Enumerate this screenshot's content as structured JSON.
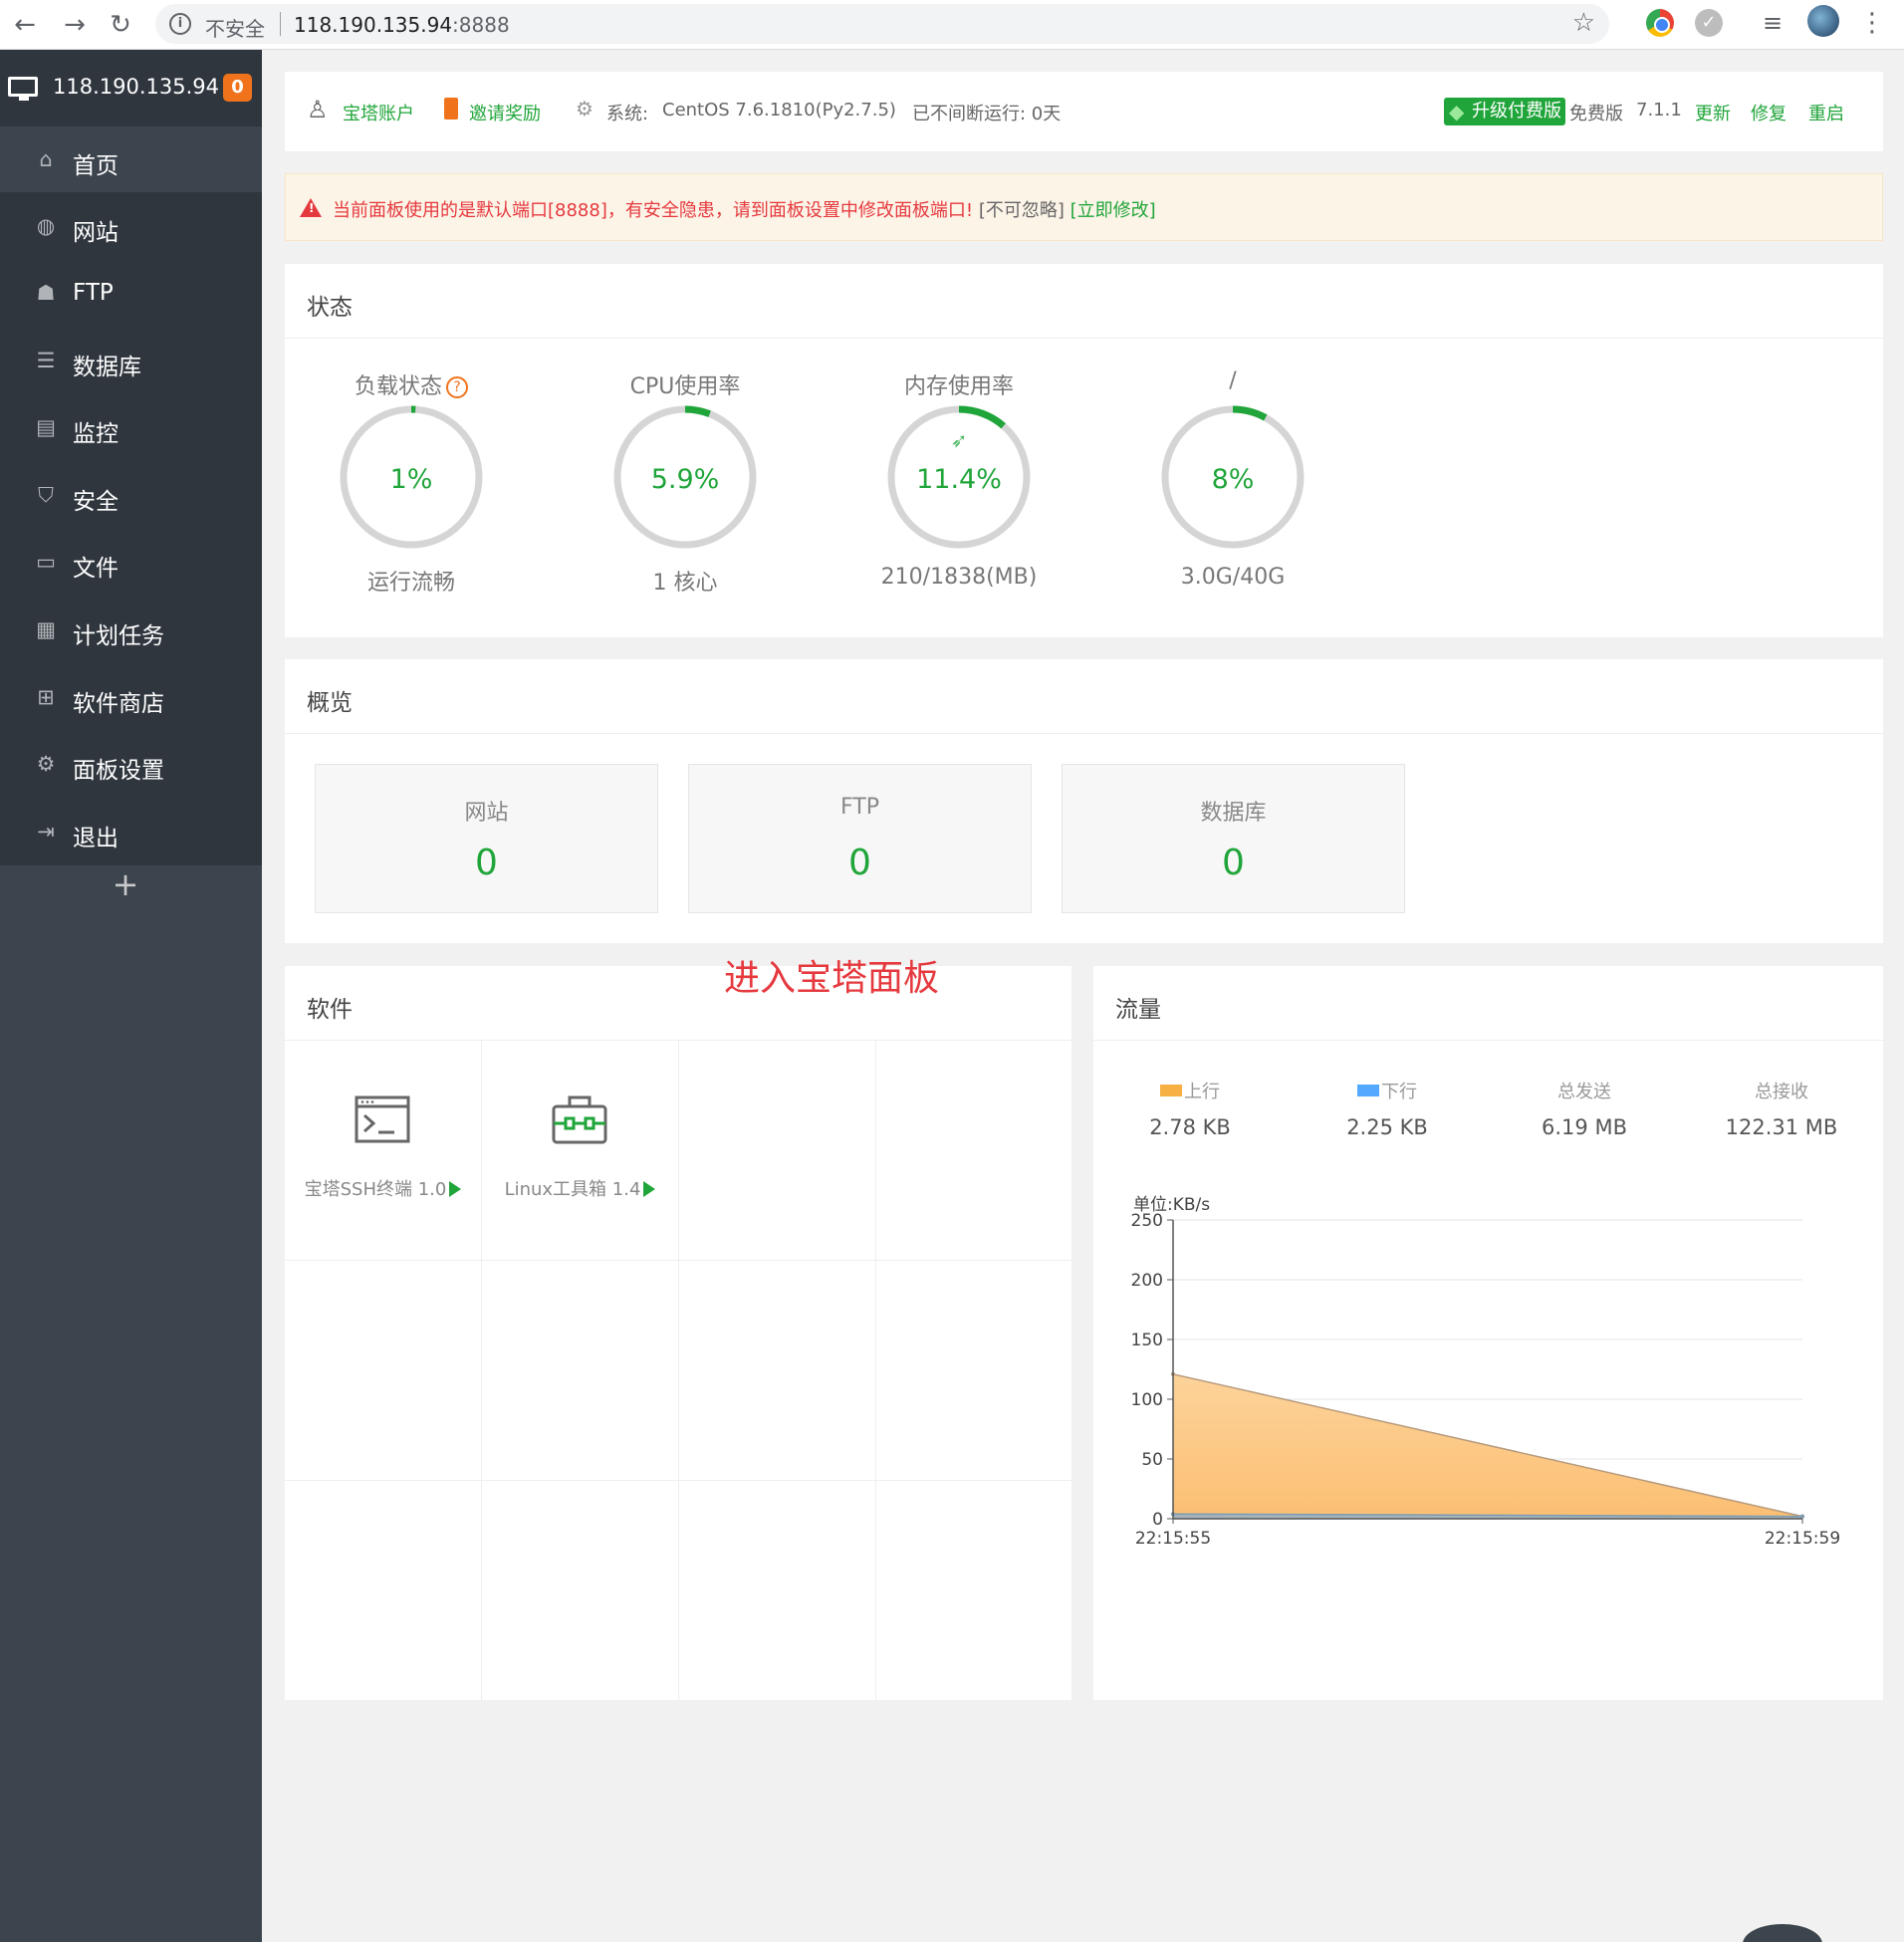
{
  "browser": {
    "insecure_label": "不安全",
    "url_host": "118.190.135.94",
    "url_port": ":8888"
  },
  "sidebar": {
    "ip": "118.190.135.94",
    "badge": "0",
    "items": [
      {
        "label": "首页",
        "icon": "home-icon"
      },
      {
        "label": "网站",
        "icon": "globe-icon"
      },
      {
        "label": "FTP",
        "icon": "ftp-icon"
      },
      {
        "label": "数据库",
        "icon": "database-icon"
      },
      {
        "label": "监控",
        "icon": "monitor-icon"
      },
      {
        "label": "安全",
        "icon": "shield-icon"
      },
      {
        "label": "文件",
        "icon": "folder-icon"
      },
      {
        "label": "计划任务",
        "icon": "calendar-icon"
      },
      {
        "label": "软件商店",
        "icon": "apps-icon"
      },
      {
        "label": "面板设置",
        "icon": "gear-icon"
      },
      {
        "label": "退出",
        "icon": "logout-icon"
      }
    ],
    "add": "+"
  },
  "topbar": {
    "account": "宝塔账户",
    "invite": "邀请奖励",
    "system_label": "系统:",
    "system_value": "CentOS 7.6.1810(Py2.7.5)",
    "uptime": "已不间断运行: 0天",
    "upgrade": "升级付费版",
    "edition": "免费版",
    "version": "7.1.1",
    "update": "更新",
    "repair": "修复",
    "restart": "重启"
  },
  "alert": {
    "message": "当前面板使用的是默认端口[8888]，有安全隐患，请到面板设置中修改面板端口!",
    "ignore": "[不可忽略]",
    "fix": "[立即修改]"
  },
  "status": {
    "title": "状态",
    "gauges": [
      {
        "title": "负载状态",
        "value": "1%",
        "percent": 1,
        "sub": "运行流畅"
      },
      {
        "title": "CPU使用率",
        "value": "5.9%",
        "percent": 5.9,
        "sub": "1 核心"
      },
      {
        "title": "内存使用率",
        "value": "11.4%",
        "percent": 11.4,
        "sub": "210/1838(MB)"
      },
      {
        "title": "/",
        "value": "8%",
        "percent": 8,
        "sub": "3.0G/40G"
      }
    ]
  },
  "overview": {
    "title": "概览",
    "cards": [
      {
        "label": "网站",
        "value": "0"
      },
      {
        "label": "FTP",
        "value": "0"
      },
      {
        "label": "数据库",
        "value": "0"
      }
    ]
  },
  "software": {
    "title": "软件",
    "items": [
      {
        "label": "宝塔SSH终端 1.0",
        "icon": "terminal-icon"
      },
      {
        "label": "Linux工具箱 1.4",
        "icon": "toolbox-icon"
      }
    ]
  },
  "overlay_text": "进入宝塔面板",
  "traffic": {
    "title": "流量",
    "stats": [
      {
        "label": "上行",
        "value": "2.78 KB",
        "color": "#f6b043"
      },
      {
        "label": "下行",
        "value": "2.25 KB",
        "color": "#52a9ff"
      },
      {
        "label": "总发送",
        "value": "6.19 MB"
      },
      {
        "label": "总接收",
        "value": "122.31 MB"
      }
    ]
  },
  "chart_data": {
    "type": "area",
    "ylabel": "单位:KB/s",
    "ylim": [
      0,
      250
    ],
    "yticks": [
      0,
      50,
      100,
      150,
      200,
      250
    ],
    "x": [
      "22:15:55",
      "22:15:59"
    ],
    "series": [
      {
        "name": "上行",
        "color": "#f6b043",
        "values": [
          121,
          2
        ]
      },
      {
        "name": "下行",
        "color": "#7cb5ec",
        "values": [
          4,
          2
        ]
      }
    ],
    "grid": true
  },
  "colors": {
    "accent": "#20a53a",
    "sidebar": "#3c444d",
    "warning": "#e5393e"
  }
}
